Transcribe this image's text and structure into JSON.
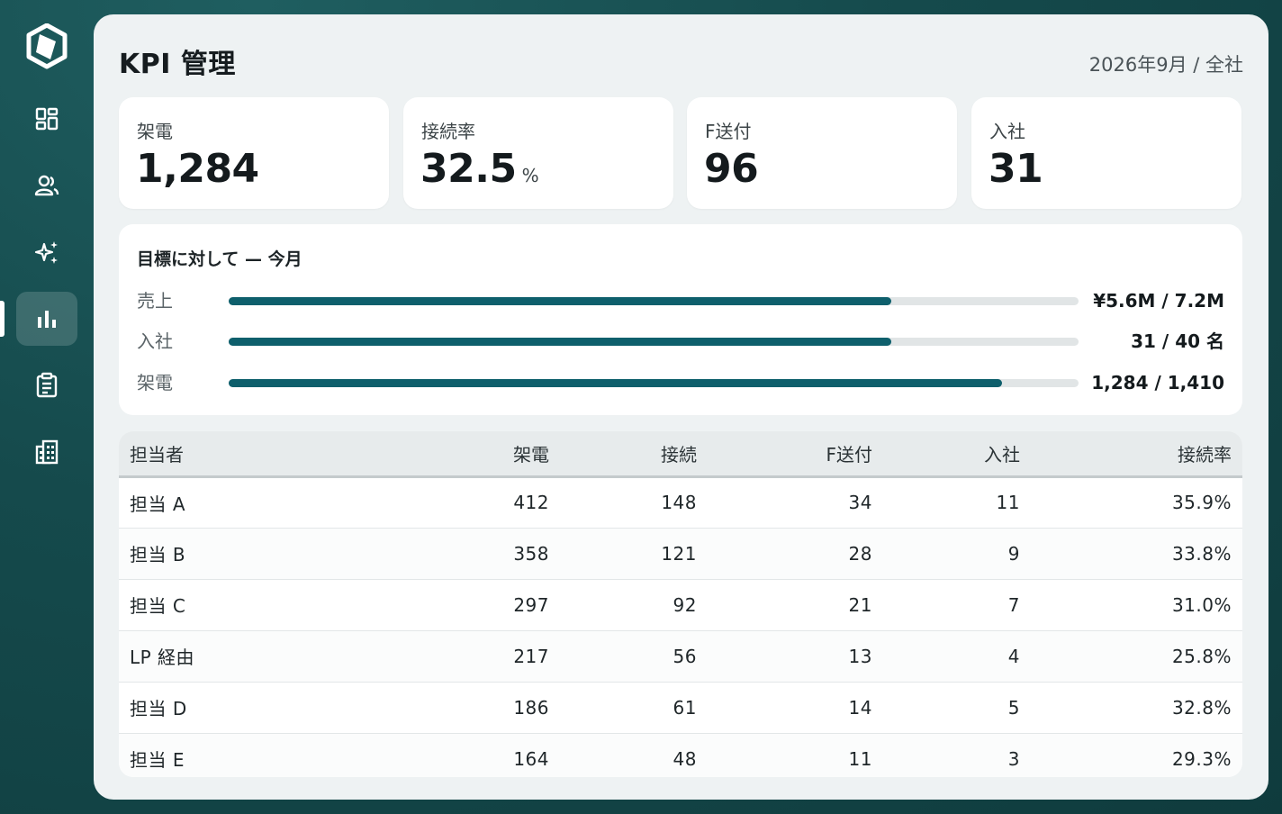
{
  "nav": {
    "items": [
      {
        "name": "dashboard",
        "icon": "dashboard-grid-icon"
      },
      {
        "name": "users",
        "icon": "users-icon"
      },
      {
        "name": "ai",
        "icon": "sparkles-icon"
      },
      {
        "name": "kpi",
        "icon": "bar-chart-icon",
        "active": true
      },
      {
        "name": "reports",
        "icon": "clipboard-icon"
      },
      {
        "name": "company",
        "icon": "building-icon"
      }
    ]
  },
  "header": {
    "title": "KPI 管理",
    "period": "2026年9月 / 全社"
  },
  "kpis": [
    {
      "label": "架電",
      "value": "1,284",
      "unit": ""
    },
    {
      "label": "接続率",
      "value": "32.5",
      "unit": "%"
    },
    {
      "label": "F送付",
      "value": "96",
      "unit": ""
    },
    {
      "label": "入社",
      "value": "31",
      "unit": ""
    }
  ],
  "progress": {
    "title": "目標に対して — 今月",
    "rows": [
      {
        "label": "売上",
        "value": "¥5.6M / 7.2M",
        "ratio": 0.78
      },
      {
        "label": "入社",
        "value": "31 / 40 名",
        "ratio": 0.78
      },
      {
        "label": "架電",
        "value": "1,284 / 1,410",
        "ratio": 0.91
      }
    ]
  },
  "table": {
    "headers": [
      "担当者",
      "架電",
      "接続",
      "F送付",
      "入社",
      "接続率"
    ],
    "rows": [
      [
        "担当 A",
        "412",
        "148",
        "34",
        "11",
        "35.9%"
      ],
      [
        "担当 B",
        "358",
        "121",
        "28",
        "9",
        "33.8%"
      ],
      [
        "担当 C",
        "297",
        "92",
        "21",
        "7",
        "31.0%"
      ],
      [
        "LP 経由",
        "217",
        "56",
        "13",
        "4",
        "25.8%"
      ],
      [
        "担当 D",
        "186",
        "61",
        "14",
        "5",
        "32.8%"
      ],
      [
        "担当 E",
        "164",
        "48",
        "11",
        "3",
        "29.3%"
      ]
    ]
  },
  "colors": {
    "accent": "#0e5f6c",
    "background": "#154a4c",
    "track": "#e1e5e6"
  }
}
